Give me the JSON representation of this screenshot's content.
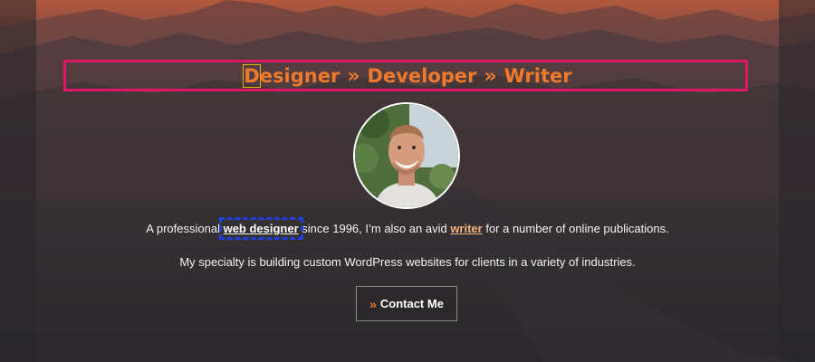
{
  "hero": {
    "headline": {
      "first_letter": "D",
      "word1_rest": "esigner",
      "separator": "»",
      "word2": "Developer",
      "word3": "Writer"
    },
    "intro": {
      "before_link": "A professional ",
      "link1": "web designer",
      "middle": " since 1996, I’m also an avid ",
      "link2": "writer",
      "after_link": " for a number of online publications."
    },
    "specialty": "My specialty is building custom WordPress websites for clients in a variety of industries.",
    "contact_button": {
      "icon": "»",
      "label": "Contact Me"
    }
  },
  "colors": {
    "accent": "#f07a2b",
    "highlight_box": "#e01765",
    "focus_outline": "#1f3fe0",
    "letter_box": "#f2b400",
    "background": "#2c2a2c"
  }
}
